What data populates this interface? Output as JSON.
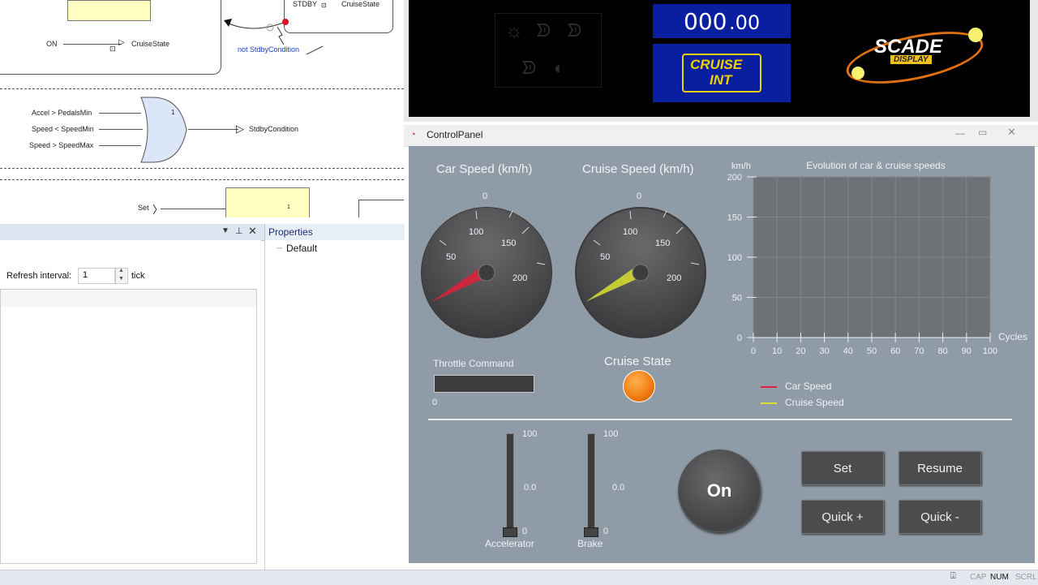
{
  "diagram": {
    "top_labels": [
      "STDBY",
      "CruiseState"
    ],
    "on_label": "ON",
    "on_target": "CruiseState",
    "stdby_condition_note": "not StdbyCondition",
    "or_inputs": [
      "Accel > PedalsMin",
      "Speed < SpeedMin",
      "Speed > SpeedMax"
    ],
    "or_gate_index": "1",
    "or_output": "StdbyCondition",
    "set_label": "Set",
    "set_box_index": "1"
  },
  "panels": {
    "properties_tab": "Properties",
    "default_item": "Default",
    "refresh_label": "Refresh interval:",
    "refresh_value": "1",
    "refresh_unit": "tick"
  },
  "display": {
    "speed_readout_int": "000",
    "speed_readout_dec": ".00",
    "cruise_sign_line1": "CRUISE",
    "cruise_sign_line2": "INT",
    "logo_line1": "SCADE",
    "logo_line2": "DISPLAY"
  },
  "control_panel": {
    "title": "ControlPanel",
    "car_speed_title": "Car Speed (km/h)",
    "cruise_speed_title": "Cruise Speed (km/h)",
    "gauge_ticks": [
      "0",
      "50",
      "100",
      "150",
      "200"
    ],
    "throttle_label": "Throttle Command",
    "throttle_value": "0",
    "cruise_state_label": "Cruise State",
    "chart_legend": [
      "Car Speed",
      "Cruise Speed"
    ],
    "accelerator_label": "Accelerator",
    "brake_label": "Brake",
    "slider_max": "100",
    "slider_mid": "0.0",
    "slider_min": "0",
    "on_button": "On",
    "set_button": "Set",
    "resume_button": "Resume",
    "quick_plus_button": "Quick +",
    "quick_minus_button": "Quick -"
  },
  "status_bar": {
    "cap": "CAP",
    "num": "NUM",
    "scrl": "SCRL"
  },
  "colors": {
    "panel_bg": "#8f9ca8",
    "car_speed": "#e0203a",
    "cruise_speed": "#d8e030",
    "cruise_state": "#f07a10",
    "display_blue": "#0a1ea0"
  },
  "chart_data": {
    "type": "line",
    "title": "Evolution of car & cruise speeds",
    "xlabel": "Cycles",
    "ylabel": "km/h",
    "xlim": [
      0,
      100
    ],
    "ylim": [
      0,
      200
    ],
    "x_ticks": [
      0,
      10,
      20,
      30,
      40,
      50,
      60,
      70,
      80,
      90,
      100
    ],
    "y_ticks": [
      0,
      50,
      100,
      150,
      200
    ],
    "grid": true,
    "legend": "bottom-left",
    "series": [
      {
        "name": "Car Speed",
        "color": "#e0203a",
        "x": [],
        "y": []
      },
      {
        "name": "Cruise Speed",
        "color": "#d8e030",
        "x": [],
        "y": []
      }
    ]
  }
}
